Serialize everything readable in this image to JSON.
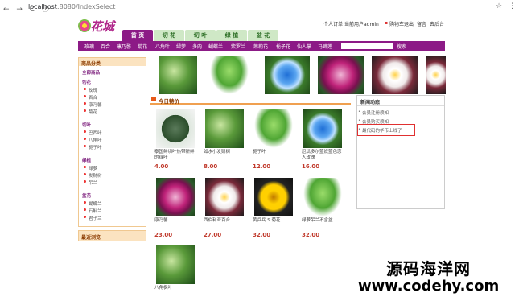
{
  "browser": {
    "nav": "← → C ⓘ",
    "url_host": "localhost",
    "url_rest": ":8080/IndexSelect",
    "star": "☆",
    "menu": "⋮"
  },
  "header": {
    "logo_text": "花城",
    "links": [
      "个人订单",
      "当前用户admin",
      "购物车",
      "退出",
      "留言",
      "去后台"
    ]
  },
  "tabs": [
    "首 页",
    "切 花",
    "切 叶",
    "绿 植",
    "盆 花"
  ],
  "navbar": {
    "items": [
      "玫瑰",
      "百合",
      "康乃馨",
      "菊花",
      "八角叶",
      "绿萝",
      "多肉",
      "蝴蝶兰",
      "紫罗兰",
      "茉莉花",
      "栀子花",
      "仙人掌",
      "马蹄莲"
    ],
    "search_label": "搜索"
  },
  "sidebar": {
    "title": "商品分类",
    "all": "全部商品",
    "sections": [
      {
        "name": "切花",
        "items": [
          "玫瑰",
          "百合",
          "康乃馨",
          "菊花"
        ]
      },
      {
        "name": "切叶",
        "items": [
          "巴西叶",
          "八角叶",
          "栀子叶"
        ]
      },
      {
        "name": "绿植",
        "items": [
          "绿萝",
          "发财树",
          "吊兰"
        ]
      },
      {
        "name": "盆花",
        "items": [
          "蝴蝶兰",
          "石斛兰",
          "君子兰"
        ]
      }
    ],
    "recent_title": "最近浏览"
  },
  "special": {
    "title": "今日特价",
    "products": [
      {
        "name": "泰国鲜切叶热带新鲜的绿叶",
        "price": "4.00"
      },
      {
        "name": "如水小发财树",
        "price": "8.00"
      },
      {
        "name": "栀子叶",
        "price": "12.00"
      },
      {
        "name": "厄瓜多尔蓝妖蓝色恋人玫瑰",
        "price": "16.00"
      },
      {
        "name": "康乃馨",
        "price": "23.00"
      },
      {
        "name": "西伯利亚百合",
        "price": "27.00"
      },
      {
        "name": "黄乒乓 S 菊花",
        "price": "32.00"
      },
      {
        "name": "绿萝吊兰不含盆",
        "price": "32.00"
      },
      {
        "name": "八角枫叶",
        "price": ""
      }
    ]
  },
  "news": {
    "title": "新闻动态",
    "items": [
      "会员注册须知",
      "会员购买须知",
      "最代码的华币上线了"
    ]
  },
  "watermark": {
    "line1": "源码海洋网",
    "line2": "www.codehy.com"
  }
}
